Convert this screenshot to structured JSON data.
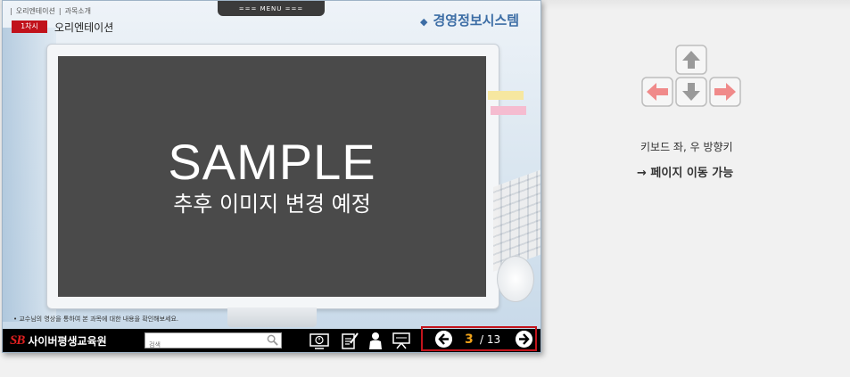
{
  "window": {
    "breadcrumb": [
      "오리엔테이션",
      "과목소개"
    ],
    "menu_label": "===  MENU  ===",
    "lesson_badge": "1차시",
    "lesson_title": "오리엔테이션",
    "course_title": "경영정보시스템"
  },
  "video": {
    "sample_text": "SAMPLE",
    "sample_sub": "추후 이미지 변경 예정",
    "note": "• 교수님의 영상을 통하여 본 과목에 대한 내용을 확인해보세요."
  },
  "footer": {
    "logo_mark": "SB",
    "logo_text": "사이버평생교육원",
    "search_placeholder": "검색",
    "tools": [
      "monitor-icon",
      "note-icon",
      "person-icon",
      "presentation-icon"
    ]
  },
  "pager": {
    "current": "3",
    "total": "/ 13"
  },
  "help": {
    "keys": [
      "up-arrow-key",
      "left-arrow-key",
      "down-arrow-key",
      "right-arrow-key"
    ],
    "line1": "키보드 좌, 우 방향키",
    "line2": "→ 페이지 이동 가능"
  },
  "colors": {
    "accent_red": "#c3141c",
    "page_orange": "#f0a21a",
    "title_blue": "#3c6da5",
    "active_key": "#f08a8a"
  }
}
